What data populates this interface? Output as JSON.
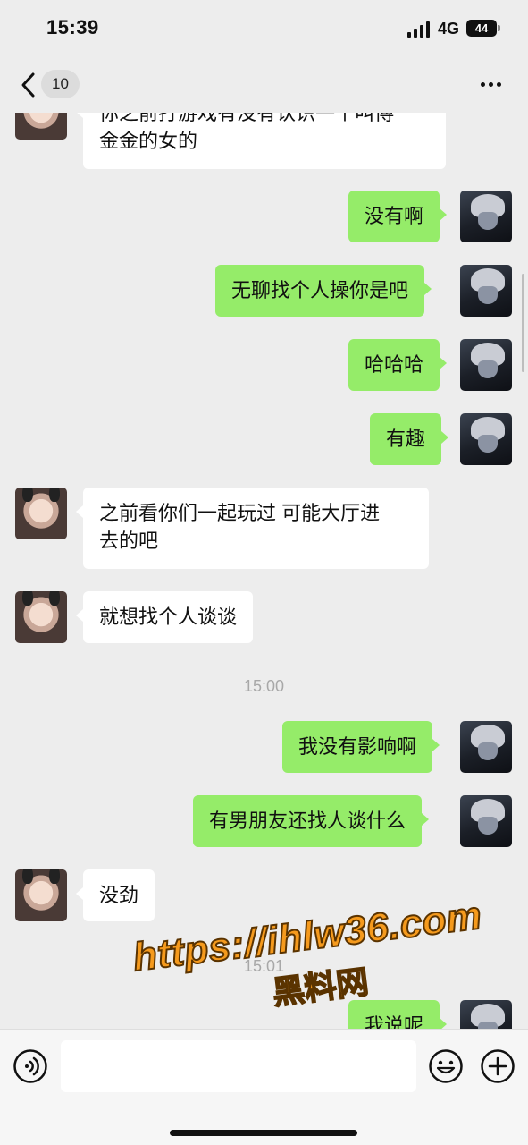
{
  "status_bar": {
    "time": "15:39",
    "network": "4G",
    "battery": "44"
  },
  "nav": {
    "unread_count": "10"
  },
  "messages": [
    {
      "from": "her",
      "text_lines": [
        "你之前打游戏有没有认识一个叫傅",
        "金金的女的"
      ]
    },
    {
      "from": "me",
      "text": "没有啊"
    },
    {
      "from": "me",
      "text": "无聊找个人操你是吧"
    },
    {
      "from": "me",
      "text": "哈哈哈"
    },
    {
      "from": "me",
      "text": "有趣"
    },
    {
      "from": "her",
      "text_lines": [
        "之前看你们一起玩过 可能大厅进",
        "去的吧"
      ]
    },
    {
      "from": "her",
      "text": "就想找个人谈谈"
    },
    {
      "from": "me",
      "text": "我没有影响啊"
    },
    {
      "from": "me",
      "text": "有男朋友还找人谈什么"
    },
    {
      "from": "her",
      "text": "没劲"
    },
    {
      "from": "me",
      "text": "我说呢"
    }
  ],
  "timestamps": [
    "15:00",
    "15:01"
  ],
  "watermark": {
    "url": "https://ihlw36.com",
    "site": "黑料网"
  },
  "input_bar": {
    "value": "",
    "placeholder": ""
  },
  "icons": {
    "back": "chevron-left-icon",
    "more": "more-dots-icon",
    "voice": "voice-icon",
    "emoji": "emoji-icon",
    "plus": "plus-icon"
  },
  "colors": {
    "background": "#ededed",
    "outgoing_bubble": "#95ec69",
    "incoming_bubble": "#ffffff",
    "timestamp": "#a8a8a8",
    "watermark": "#f59a1d"
  }
}
